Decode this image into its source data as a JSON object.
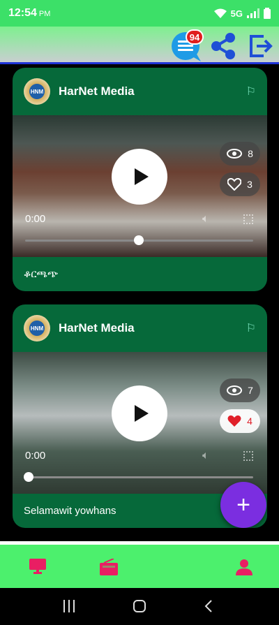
{
  "status_bar": {
    "time": "12:54",
    "ampm": "PM",
    "network": "5G"
  },
  "header": {
    "notification_count": "94"
  },
  "posts": [
    {
      "channel": "HarNet Media",
      "avatar_text": "HNM",
      "time": "0:00",
      "views": "8",
      "likes": "3",
      "liked": false,
      "caption": "ቆርጫጭ",
      "progress": 0.5
    },
    {
      "channel": "HarNet Media",
      "avatar_text": "HNM",
      "time": "0:00",
      "views": "7",
      "likes": "4",
      "liked": true,
      "caption": "Selamawit yowhans",
      "progress": 0.0
    }
  ],
  "fab": {
    "label": "+"
  },
  "colors": {
    "accent": "#3ce068",
    "card": "#06693a",
    "fab": "#7b2ee0",
    "nav_icon": "#e91e63"
  }
}
